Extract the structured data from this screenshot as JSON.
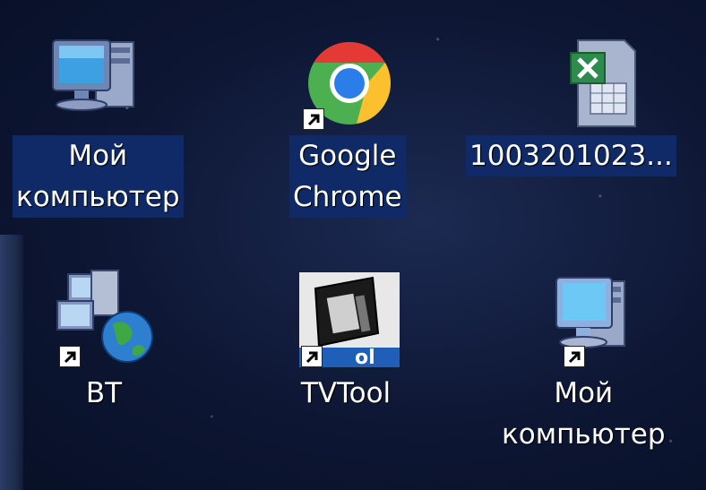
{
  "desktop": {
    "icons": [
      {
        "label": "Мой\nкомпьютер",
        "icon": "my-computer-icon",
        "selected": true
      },
      {
        "label": "Google\nChrome",
        "icon": "chrome-icon",
        "selected": true,
        "shortcut": true
      },
      {
        "label": "1003201023...",
        "icon": "excel-file-icon",
        "selected": true
      },
      {
        "label": "BT",
        "icon": "network-globe-icon",
        "selected": false,
        "shortcut": true
      },
      {
        "label": "TVTool",
        "icon": "tvtool-icon",
        "selected": false,
        "shortcut": true
      },
      {
        "label": "Мой\nкомпьютер",
        "icon": "my-computer-icon",
        "selected": false,
        "shortcut": true
      }
    ]
  }
}
